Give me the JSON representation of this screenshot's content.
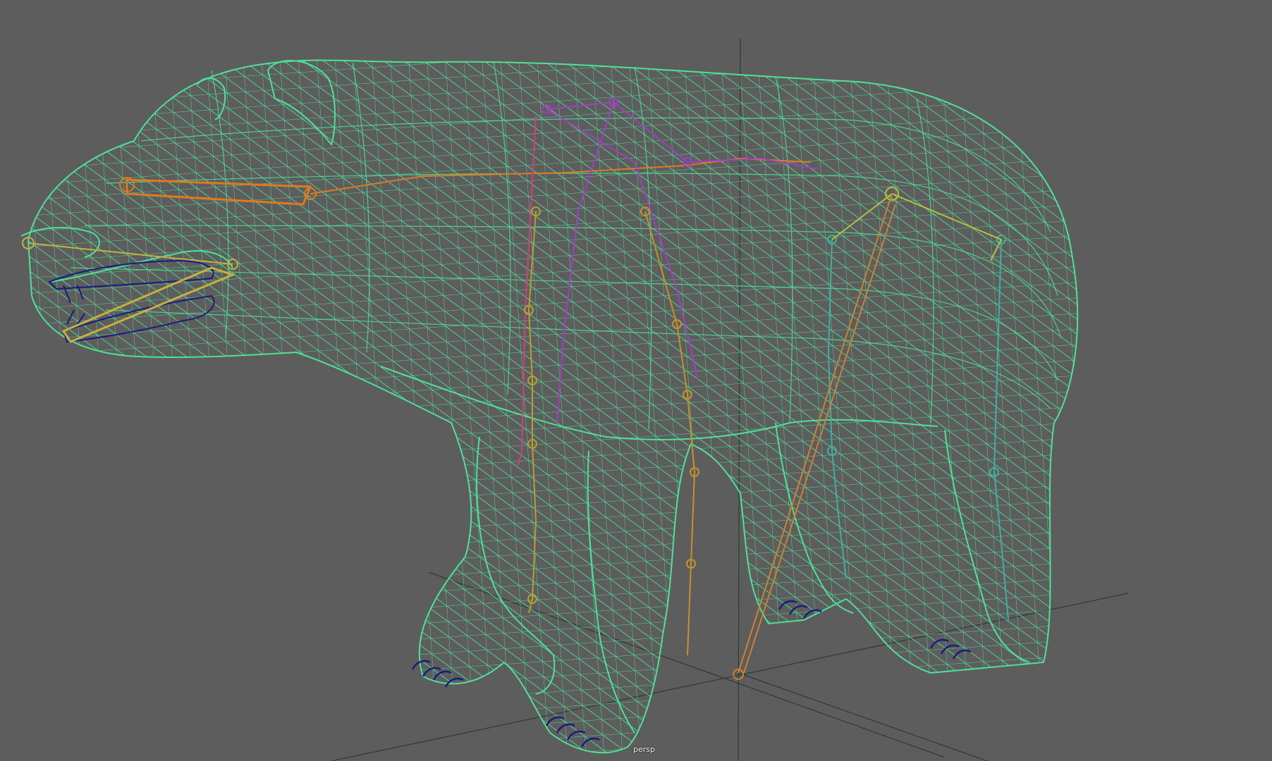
{
  "viewport": {
    "camera_label": "persp",
    "background_color": "#5d5d5d",
    "wireframe_color": "#4ee89a",
    "grid_axis_color": "#2b3d34",
    "subject": "bear-model-wireframe-with-skeleton"
  },
  "skeleton": {
    "colors": {
      "head": "#e07a20",
      "jaw": "#c8b040",
      "spine": "#a040c0",
      "front_left_leg": "#b8a030",
      "front_right_leg": "#c89028",
      "hind_legs": "#40b0a0",
      "tail_ik": "#d08030"
    }
  }
}
